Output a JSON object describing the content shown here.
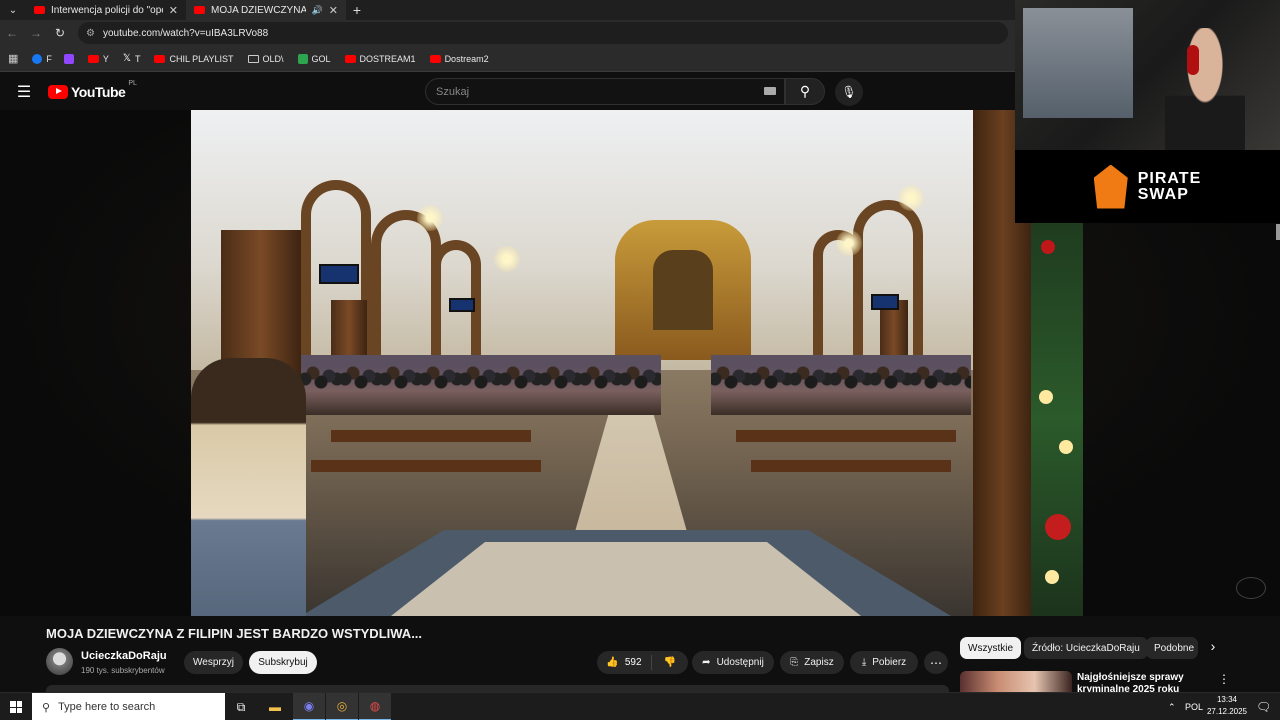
{
  "browser": {
    "tabs": [
      {
        "title": "Interwencja policji do \"opętane",
        "active": false
      },
      {
        "title": "MOJA DZIEWCZYNA Z FILIPIN",
        "active": true
      }
    ],
    "url": "youtube.com/watch?v=uIBA3LRVo88",
    "bookmarks": [
      "F",
      "Y",
      "T",
      "CHIL PLAYLIST",
      "OLD\\",
      "GOL",
      "DOSTREAM1",
      "Dostream2"
    ]
  },
  "youtube": {
    "logo": "YouTube",
    "country": "PL",
    "search_placeholder": "Szukaj"
  },
  "video": {
    "title": "MOJA DZIEWCZYNA Z FILIPIN JEST BARDZO WSTYDLIWA...",
    "channel": "UcieczkaDoRaju",
    "subscribers": "190 tys. subskrybentów",
    "support_label": "Wesprzyj",
    "subscribe_label": "Subskrybuj",
    "likes": "592",
    "share_label": "Udostępnij",
    "save_label": "Zapisz",
    "download_label": "Pobierz"
  },
  "sidebar": {
    "chips": [
      "Wszystkie",
      "Źródło: UcieczkaDoRaju",
      "Podobne"
    ],
    "rec_title": "Najgłośniejsze sprawy kryminalne 2025 roku"
  },
  "overlay": {
    "sponsor_line1": "PIRATE",
    "sponsor_line2": "SWAP"
  },
  "taskbar": {
    "search_placeholder": "Type here to search",
    "language": "POL",
    "time": "13:34",
    "date": "27.12.2025"
  }
}
